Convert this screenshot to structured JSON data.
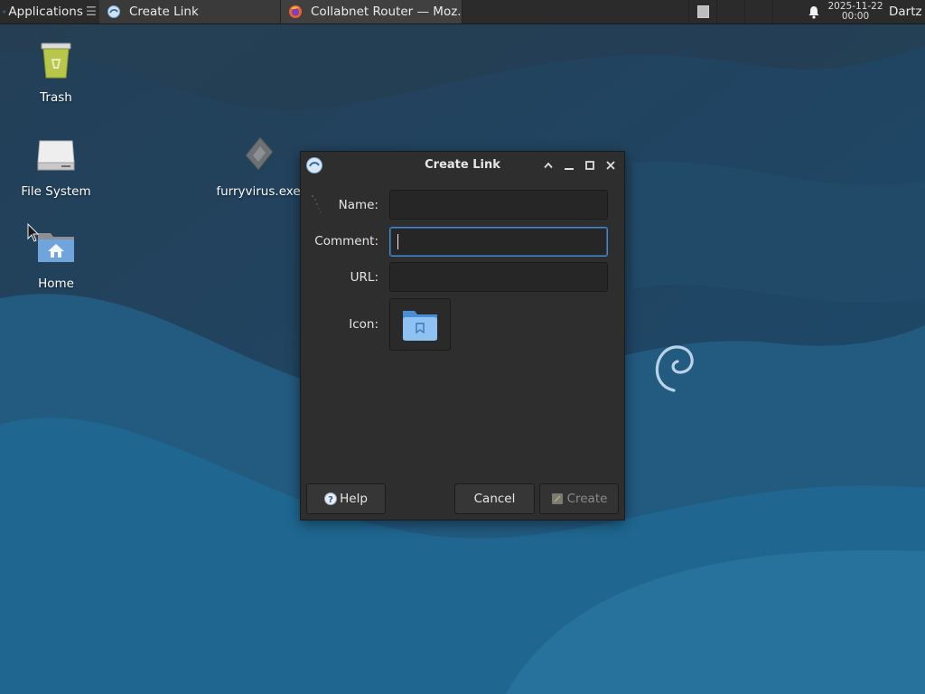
{
  "taskbar": {
    "applications_label": "Applications",
    "applications_icon": "xfce-menu-icon",
    "tasks": [
      {
        "label": "Create Link",
        "icon": "create-link-icon",
        "active": true
      },
      {
        "label": "Collabnet Router — Moz...",
        "icon": "firefox-icon",
        "active": false
      }
    ],
    "notification_icon": "bell-icon",
    "clock": {
      "date": "2025-11-22",
      "time": "00:00"
    },
    "user": "Dartz"
  },
  "desktop": {
    "icons": [
      {
        "label": "Trash",
        "icon": "trash-icon"
      },
      {
        "label": "File System",
        "icon": "drive-icon"
      },
      {
        "label": "Home",
        "icon": "home-folder-icon"
      },
      {
        "label": "furryvirus.exe",
        "icon": "exe-file-icon"
      }
    ]
  },
  "dialog": {
    "title": "Create Link",
    "name_label": "Name:",
    "name_value": "",
    "comment_label": "Comment:",
    "comment_value": "",
    "url_label": "URL:",
    "url_value": "",
    "icon_label": "Icon:",
    "help_label": "Help",
    "cancel_label": "Cancel",
    "create_label": "Create"
  },
  "colors": {
    "accent": "#4a86c8",
    "desktop_bg": "#1f4f72",
    "dialog_bg": "#2e2e2e",
    "taskbar_bg": "#2b2b2b"
  }
}
